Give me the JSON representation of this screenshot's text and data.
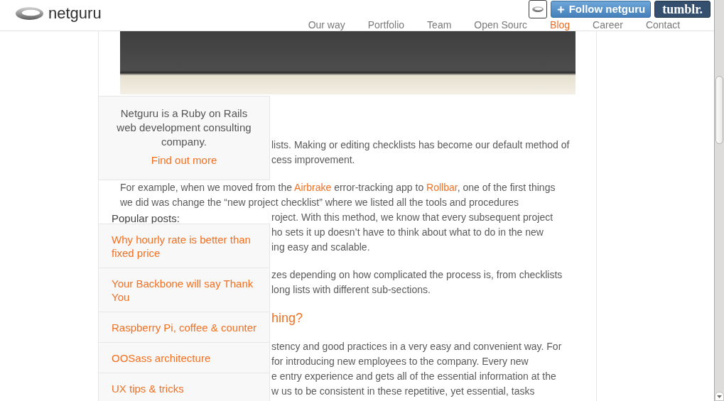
{
  "header": {
    "logo": {
      "text": "netguru"
    },
    "nav": [
      {
        "label": "Our way",
        "selected": false
      },
      {
        "label": "Portfolio",
        "selected": false
      },
      {
        "label": "Team",
        "selected": false
      },
      {
        "label": "Open Sourc",
        "selected": false
      },
      {
        "label": "Blog",
        "selected": true
      },
      {
        "label": "Career",
        "selected": false
      },
      {
        "label": "Contact",
        "selected": false
      }
    ]
  },
  "tumblr_bar": {
    "follow_button": {
      "label": "Follow netguru"
    },
    "brand_button": {
      "label": "tumblr."
    }
  },
  "article": {
    "blocks": [
      {
        "kind": "paragraph",
        "lines": [
          {
            "text": "lists. Making or editing checklists has become our default method of",
            "covered": true
          },
          {
            "text": "cess improvement.",
            "covered": true
          }
        ]
      },
      {
        "kind": "paragraph",
        "lines": [
          {
            "parts": [
              {
                "kind": "text",
                "text": "For example, when we moved from the "
              },
              {
                "kind": "link",
                "text": "Airbrake"
              },
              {
                "kind": "text",
                "text": " error-tracking app to "
              },
              {
                "kind": "link",
                "text": "Rollbar"
              },
              {
                "kind": "text",
                "text": ", one of the first things"
              }
            ],
            "covered": false
          },
          {
            "text": "we did was change the “new project checklist” where we listed all the tools and procedures",
            "covered": false
          },
          {
            "text": "roject. With this method, we know that every subsequent project",
            "covered": true
          },
          {
            "text": "ho sets it up doesn’t have to think about what to do in the new",
            "covered": true
          },
          {
            "text": "ing easy and scalable.",
            "covered": true
          }
        ]
      },
      {
        "kind": "paragraph",
        "lines": [
          {
            "text": "zes depending on how complicated the process is, from checklists",
            "covered": true
          },
          {
            "text": "long lists with different sub-sections.",
            "covered": true
          }
        ]
      },
      {
        "kind": "heading",
        "lines": [
          {
            "text": "hing?",
            "covered": true
          }
        ]
      },
      {
        "kind": "paragraph",
        "lines": [
          {
            "text": "stency and good practices in a very easy and convenient way. For",
            "covered": true
          },
          {
            "text": "for introducing new employees to the company. Every new",
            "covered": true
          },
          {
            "text": "e entry experience and gets all of the essential information at the",
            "covered": true
          },
          {
            "text": "w us to be consistent in these repetitive, yet essential, tasks",
            "covered": true
          }
        ]
      }
    ]
  },
  "sidebar": {
    "about": {
      "text": "Netguru is a Ruby on Rails web development consulting company.",
      "link": "Find out more"
    },
    "popular_title": "Popular posts:",
    "posts": [
      "Why hourly rate is better than fixed price",
      "Your Backbone will say Thank You",
      "Raspberry Pi, coffee & counter",
      "OOSass architecture",
      "UX tips & tricks"
    ]
  }
}
